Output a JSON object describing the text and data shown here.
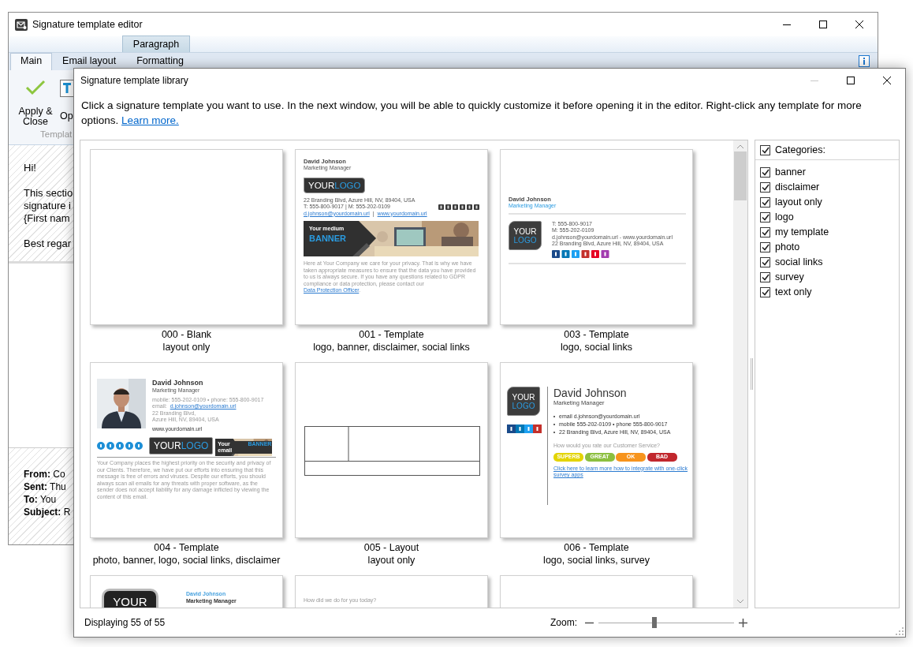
{
  "editor": {
    "title": "Signature template editor",
    "context_group": "Paragraph",
    "tabs": [
      {
        "label": "Main",
        "selected": true
      },
      {
        "label": "Email layout",
        "selected": false
      },
      {
        "label": "Formatting",
        "selected": false
      }
    ],
    "apply_button": "Apply & Close",
    "open_button": "Op",
    "group_label": "Templat",
    "message": {
      "greeting": "Hi!",
      "lines": [
        "This sectio",
        "signature i",
        "{First nam"
      ],
      "closing": "Best regar"
    },
    "header_lines": [
      "**From:** Co",
      "**Sent:** Thu",
      "**To:** You",
      "**Subject:** R"
    ]
  },
  "library": {
    "title": "Signature template library",
    "intro": "Click a signature template you want to use. In the next window, you will be able to quickly customize it before opening it in the editor. Right-click any template for more options.",
    "learn_more": "Learn more.",
    "templates": [
      {
        "label": "000 - Blank",
        "tags": "layout only",
        "preview": {
          "kind": "blank"
        }
      },
      {
        "label": "001 - Template",
        "tags": "logo, banner, disclaimer, social links",
        "preview": {
          "kind": "classic",
          "name": "David Johnson",
          "job_title": "Marketing Manager",
          "logo": [
            "YOUR",
            "LOGO"
          ],
          "lines": [
            "22 Branding Blvd, Azure Hill, NV, 89404, USA",
            "T: 555-800-9017 | M: 555-202-0109"
          ],
          "email": "d.johnson@yourdomain.url",
          "separator": "|",
          "site": "www.yourdomain.url",
          "banner": [
            "Your medium",
            "BANNER"
          ],
          "disclaimer": "Here at Your Company we care for your privacy. That is why we have taken appropriate measures to ensure that the data you have provided to us is always secure. If you have any questions related to GDPR compliance or data protection, please contact our",
          "disclaimer_link": "Data Protection Officer",
          "disclaimer_end": "."
        }
      },
      {
        "label": "003 - Template",
        "tags": "logo, social links",
        "preview": {
          "kind": "compact",
          "name": "David Johnson",
          "job_title": "Marketing Manager",
          "logo": [
            "YOUR",
            "LOGO"
          ],
          "lines": [
            "T: 555-800-9017",
            "M: 555-202-0109",
            "d.johnson@yourdomain.url - www.yourdomain.url",
            "22 Branding Blvd, Azure Hill, NV, 89404, USA"
          ]
        }
      },
      {
        "label": "004 - Template",
        "tags": "photo, banner, logo, social links, disclaimer",
        "preview": {
          "name": "David Johnson",
          "job_title": "Marketing Manager",
          "phones": "mobile: 555-202-0109 • phone: 555-800-9017",
          "email_label": "email:",
          "email": "d.johnson@yourdomain.url",
          "lines": [
            "22 Branding Blvd,",
            "Azure Hill, NV, 89404, USA"
          ],
          "site": "www.yourdomain.url",
          "logo": [
            "YOUR",
            "LOGO"
          ],
          "banner": [
            "Your email",
            "BANNER"
          ],
          "disclaimer": "Your Company places the highest priority on the security and privacy of our Clients. Therefore, we have put our efforts into ensuring that this message is free of errors and viruses. Despite our efforts, you should always scan all emails for any threats with proper software, as the sender does not accept liability for any damage inflicted by viewing the content of this email."
        }
      },
      {
        "label": "005 - Layout",
        "tags": "layout only",
        "preview": {
          "kind": "layout"
        }
      },
      {
        "label": "006 - Template",
        "tags": "logo, social links, survey",
        "preview": {
          "kind": "survey",
          "name": "David Johnson",
          "job_title": "Marketing Manager",
          "logo": [
            "YOUR",
            "LOGO"
          ],
          "lines": [
            "email d.johnson@yourdomain.url",
            "mobile 555-202-0109 • phone 555-800-9017",
            "22 Branding Blvd, Azure Hill, NV, 89404, USA"
          ],
          "question": "How would you rate our Customer Service?",
          "ratings": [
            {
              "label": "SUPERB",
              "color": "#e3d400"
            },
            {
              "label": "GREAT",
              "color": "#8cbf3f"
            },
            {
              "label": "OK",
              "color": "#f7941d"
            },
            {
              "label": "BAD",
              "color": "#c1272d"
            }
          ],
          "link": "Click here to learn more how to integrate with one-click survey apps"
        }
      },
      {
        "preview": {
          "kind": "logo-top",
          "logo": [
            "YOUR"
          ],
          "name": "David Johnson",
          "job_title": "Marketing Manager"
        }
      },
      {
        "preview": {
          "kind": "question",
          "question": "How did we do for you today?"
        }
      },
      {
        "preview": {
          "kind": "blank"
        }
      }
    ],
    "categories": {
      "header": {
        "label": "Categories:",
        "checked": true
      },
      "items": [
        {
          "label": "banner",
          "checked": true
        },
        {
          "label": "disclaimer",
          "checked": true
        },
        {
          "label": "layout only",
          "checked": true
        },
        {
          "label": "logo",
          "checked": true
        },
        {
          "label": "my template",
          "checked": true
        },
        {
          "label": "photo",
          "checked": true
        },
        {
          "label": "social links",
          "checked": true
        },
        {
          "label": "survey",
          "checked": true
        },
        {
          "label": "text only",
          "checked": true
        }
      ]
    },
    "status": "Displaying 55 of 55",
    "zoom": {
      "label": "Zoom:",
      "level": 0.41
    }
  }
}
